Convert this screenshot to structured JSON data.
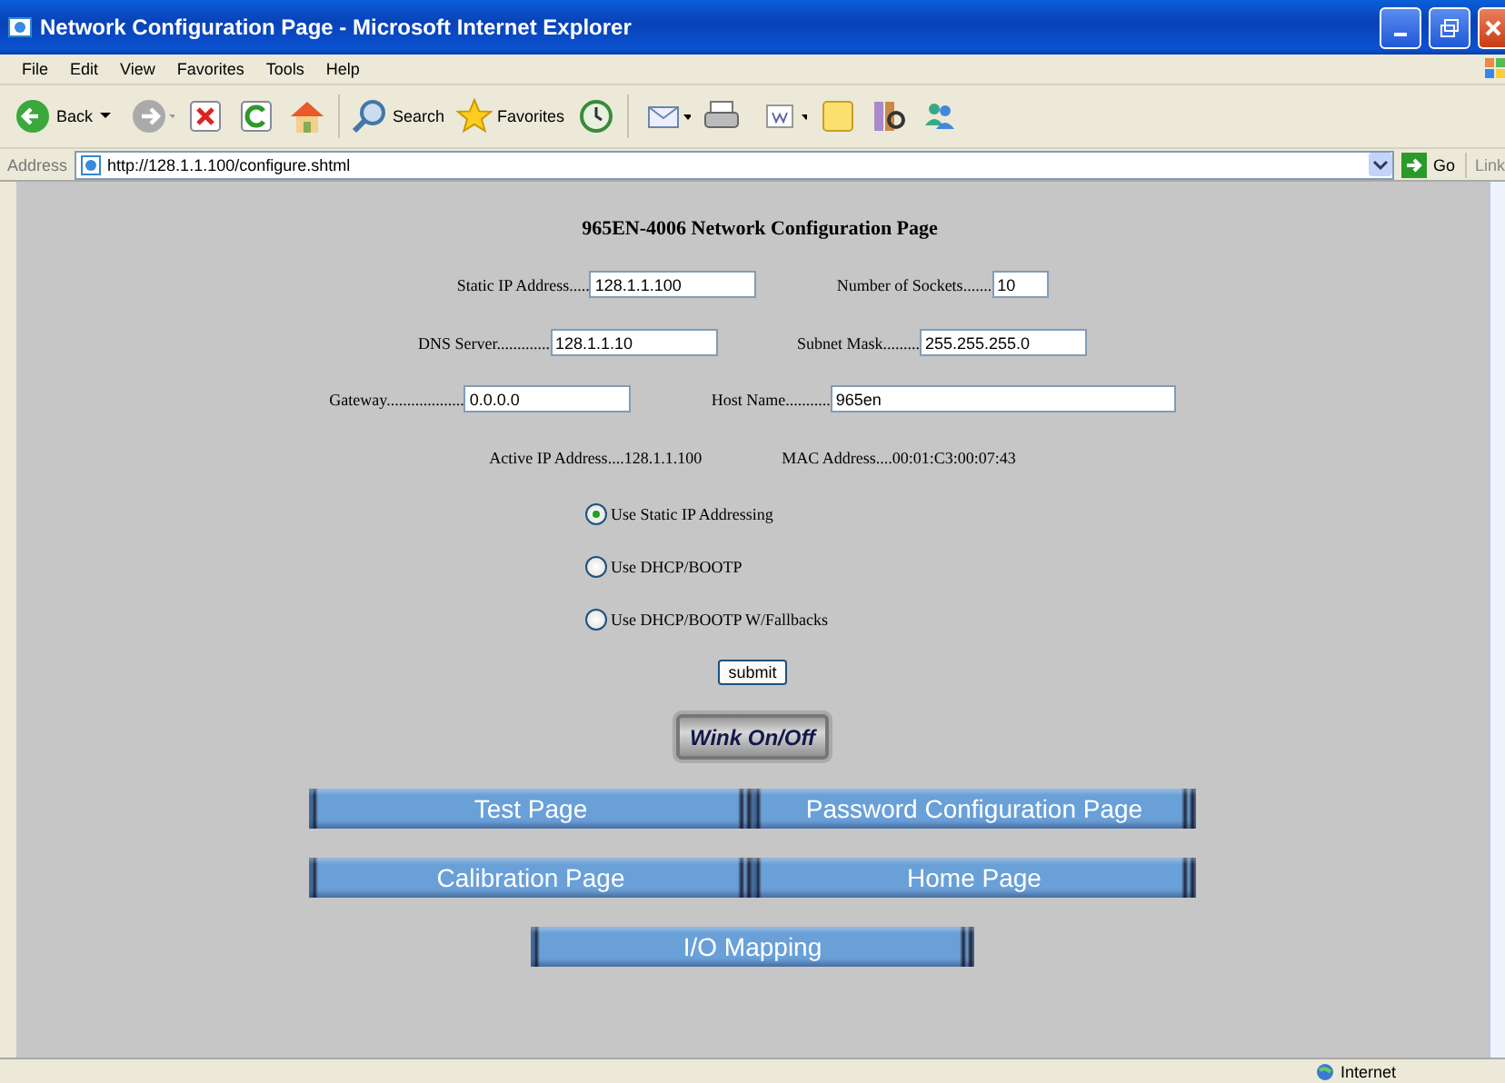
{
  "window": {
    "title": "Network Configuration Page - Microsoft Internet Explorer"
  },
  "menu": [
    "File",
    "Edit",
    "View",
    "Favorites",
    "Tools",
    "Help"
  ],
  "toolbar": {
    "back": "Back",
    "search": "Search",
    "favorites": "Favorites"
  },
  "address_bar": {
    "label": "Address",
    "url": "http://128.1.1.100/configure.shtml",
    "go": "Go",
    "links": "Link"
  },
  "page": {
    "heading": "965EN-4006 Network Configuration Page",
    "field_rows": [
      [
        {
          "label": "Static IP Address.....",
          "value": "128.1.1.100"
        },
        {
          "label": "Number of Sockets.......",
          "value": "10"
        }
      ],
      [
        {
          "label": "DNS Server.............",
          "value": "128.1.1.10"
        },
        {
          "label": "Subnet Mask.........",
          "value": "255.255.255.0"
        }
      ],
      [
        {
          "label": "Gateway...................",
          "value": "0.0.0.0"
        },
        {
          "label": "Host Name...........",
          "value": "965en"
        }
      ]
    ],
    "info": [
      "Active IP Address....128.1.1.100",
      "MAC Address....00:01:C3:00:07:43"
    ],
    "radios": [
      {
        "label": "Use Static IP Addressing",
        "selected": true
      },
      {
        "label": "Use DHCP/BOOTP",
        "selected": false
      },
      {
        "label": "Use DHCP/BOOTP W/Fallbacks",
        "selected": false
      }
    ],
    "submit": "submit",
    "wink": "Wink On/Off",
    "nav_rows": [
      [
        "Test Page",
        "Password Configuration Page"
      ],
      [
        "Calibration Page",
        "Home Page"
      ],
      [
        "I/O Mapping"
      ]
    ]
  },
  "status_bar": {
    "zone": "Internet"
  }
}
